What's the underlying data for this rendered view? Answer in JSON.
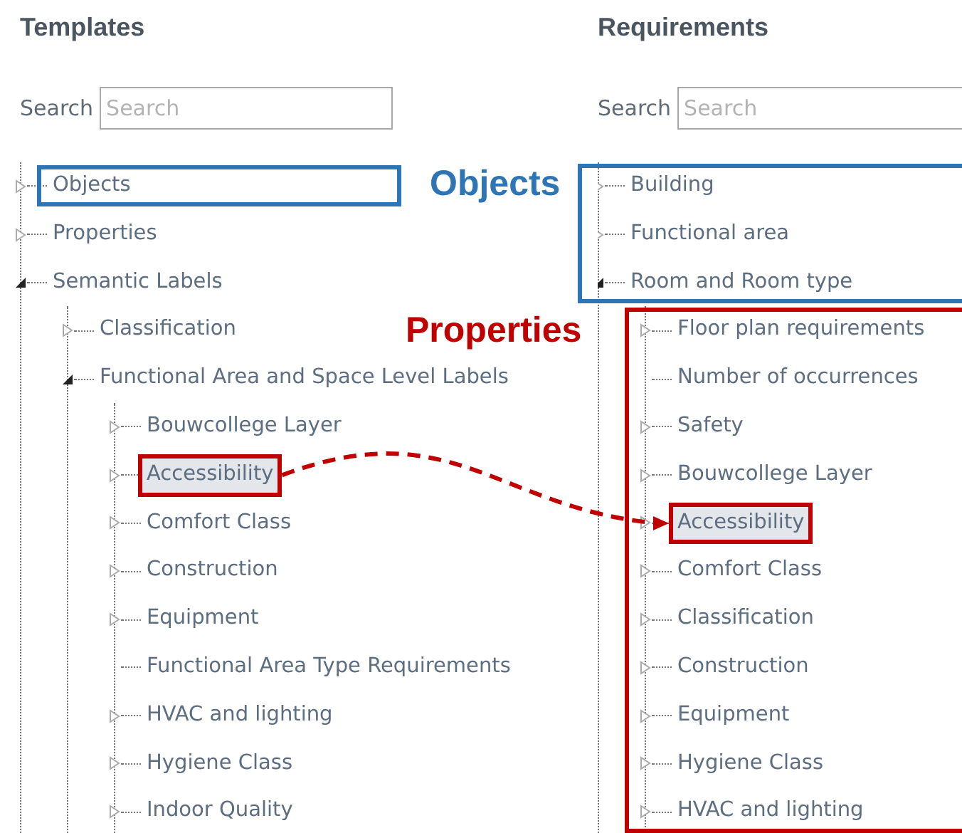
{
  "panels": [
    {
      "title": "Templates",
      "search": {
        "label": "Search",
        "placeholder": "Search"
      },
      "tree": [
        {
          "label": "Objects",
          "kind": "branch",
          "expanded": false,
          "selected": false,
          "callout": {
            "text": "Objects",
            "color": "#2e75b6"
          }
        },
        {
          "label": "Properties",
          "kind": "branch",
          "expanded": false,
          "selected": false
        },
        {
          "label": "Semantic Labels",
          "kind": "branch",
          "expanded": true,
          "selected": false,
          "children": [
            {
              "label": "Classification",
              "kind": "branch",
              "expanded": false,
              "selected": false
            },
            {
              "label": "Functional Area and Space Level Labels",
              "kind": "branch",
              "expanded": true,
              "selected": false,
              "children": [
                {
                  "label": "Bouwcollege Layer",
                  "kind": "branch",
                  "expanded": false,
                  "selected": false
                },
                {
                  "label": "Accessibility",
                  "kind": "branch",
                  "expanded": false,
                  "selected": true,
                  "frame": {
                    "color": "#c00000"
                  }
                },
                {
                  "label": "Comfort Class",
                  "kind": "branch",
                  "expanded": false,
                  "selected": false
                },
                {
                  "label": "Construction",
                  "kind": "branch",
                  "expanded": false,
                  "selected": false
                },
                {
                  "label": "Equipment",
                  "kind": "branch",
                  "expanded": false,
                  "selected": false
                },
                {
                  "label": "Functional Area Type Requirements",
                  "kind": "leaf",
                  "selected": false
                },
                {
                  "label": "HVAC and lighting",
                  "kind": "branch",
                  "expanded": false,
                  "selected": false
                },
                {
                  "label": "Hygiene Class",
                  "kind": "branch",
                  "expanded": false,
                  "selected": false
                },
                {
                  "label": "Indoor Quality",
                  "kind": "branch",
                  "expanded": false,
                  "selected": false
                }
              ]
            }
          ]
        }
      ]
    },
    {
      "title": "Requirements",
      "search": {
        "label": "Search",
        "placeholder": "Search"
      },
      "tree_frame": {
        "color": "#2e75b6"
      },
      "tree": [
        {
          "label": "Building",
          "kind": "branch",
          "expanded": false,
          "selected": false
        },
        {
          "label": "Functional area",
          "kind": "branch",
          "expanded": false,
          "selected": false
        },
        {
          "label": "Room and Room type",
          "kind": "branch",
          "expanded": true,
          "selected": false,
          "children_callout": {
            "text": "Properties",
            "color": "#c00000"
          },
          "children": [
            {
              "label": "Floor plan requirements",
              "kind": "branch",
              "expanded": false,
              "selected": false
            },
            {
              "label": "Number of occurrences",
              "kind": "leaf",
              "selected": false
            },
            {
              "label": "Safety",
              "kind": "branch",
              "expanded": false,
              "selected": false
            },
            {
              "label": "Bouwcollege Layer",
              "kind": "branch",
              "expanded": false,
              "selected": false
            },
            {
              "label": "Accessibility",
              "kind": "branch",
              "expanded": false,
              "selected": true,
              "frame": {
                "color": "#c00000"
              }
            },
            {
              "label": "Comfort Class",
              "kind": "branch",
              "expanded": false,
              "selected": false
            },
            {
              "label": "Classification",
              "kind": "branch",
              "expanded": false,
              "selected": false
            },
            {
              "label": "Construction",
              "kind": "branch",
              "expanded": false,
              "selected": false
            },
            {
              "label": "Equipment",
              "kind": "branch",
              "expanded": false,
              "selected": false
            },
            {
              "label": "Hygiene Class",
              "kind": "branch",
              "expanded": false,
              "selected": false
            },
            {
              "label": "HVAC and lighting",
              "kind": "branch",
              "expanded": false,
              "selected": false
            }
          ]
        }
      ]
    }
  ],
  "arrow": {
    "color": "#c00000"
  }
}
